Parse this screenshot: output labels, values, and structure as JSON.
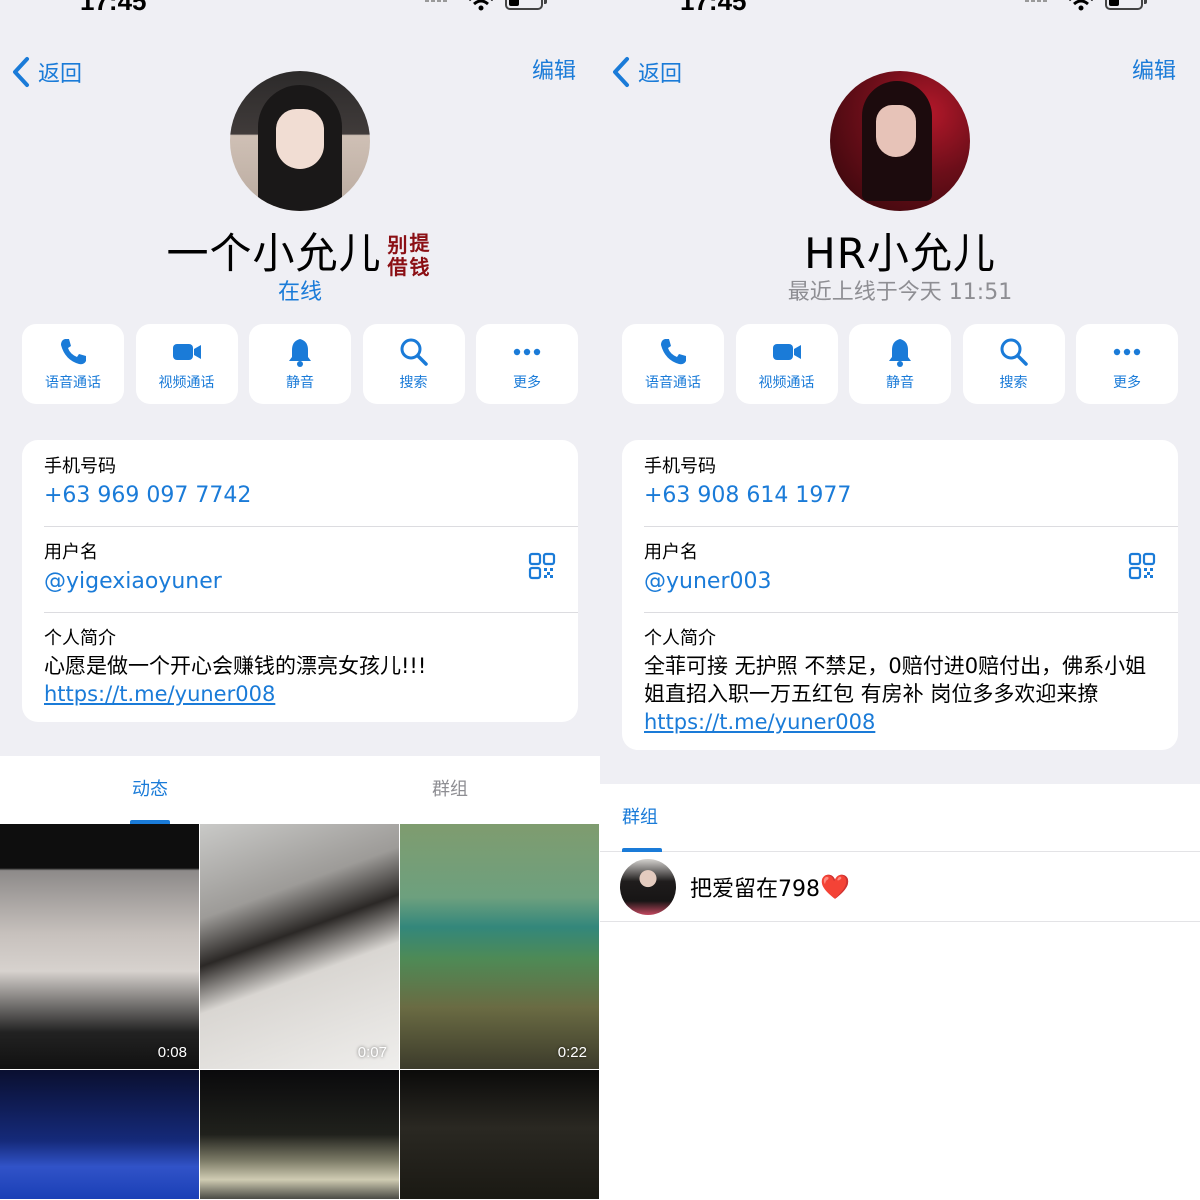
{
  "left": {
    "status_time": "17:45",
    "nav": {
      "back": "返回",
      "edit": "编辑"
    },
    "name": "一个小允儿",
    "sticker_chars": [
      "别",
      "提",
      "借",
      "钱"
    ],
    "status": "在线",
    "actions": [
      "语音通话",
      "视频通话",
      "静音",
      "搜索",
      "更多"
    ],
    "info": {
      "phone_label": "手机号码",
      "phone": "+63 969 097 7742",
      "username_label": "用户名",
      "username": "@yigexiaoyuner",
      "bio_label": "个人简介",
      "bio": "心愿是做一个开心会赚钱的漂亮女孩儿!!!",
      "bio_link": "https://t.me/yuner008"
    },
    "tabs": [
      "动态",
      "群组"
    ],
    "media": [
      {
        "duration": "0:08"
      },
      {
        "duration": "0:07"
      },
      {
        "duration": "0:22"
      },
      {
        "duration": ""
      },
      {
        "duration": ""
      },
      {
        "duration": ""
      }
    ]
  },
  "right": {
    "status_time": "17:45",
    "nav": {
      "back": "返回",
      "edit": "编辑"
    },
    "name": "HR小允儿",
    "status": "最近上线于今天 11:51",
    "actions": [
      "语音通话",
      "视频通话",
      "静音",
      "搜索",
      "更多"
    ],
    "info": {
      "phone_label": "手机号码",
      "phone": "+63 908 614 1977",
      "username_label": "用户名",
      "username": "@yuner003",
      "bio_label": "个人简介",
      "bio": "全菲可接 无护照 不禁足，0赔付进0赔付出，佛系小姐姐直招入职一万五红包 有房补 岗位多多欢迎来撩",
      "bio_link": "https://t.me/yuner008"
    },
    "group_tab": "群组",
    "groups": [
      {
        "name": "把爱留在798",
        "emoji": "❤️"
      }
    ]
  },
  "colors": {
    "accent": "#1a7bd8",
    "background": "#efeff4",
    "muted": "#8e8e93",
    "heart": "#e0212e"
  },
  "icons": [
    "phone-icon",
    "video-icon",
    "bell-icon",
    "search-icon",
    "more-icon",
    "qr-code-icon",
    "chevron-left-icon",
    "wifi-icon",
    "battery-icon",
    "signal-icon"
  ]
}
